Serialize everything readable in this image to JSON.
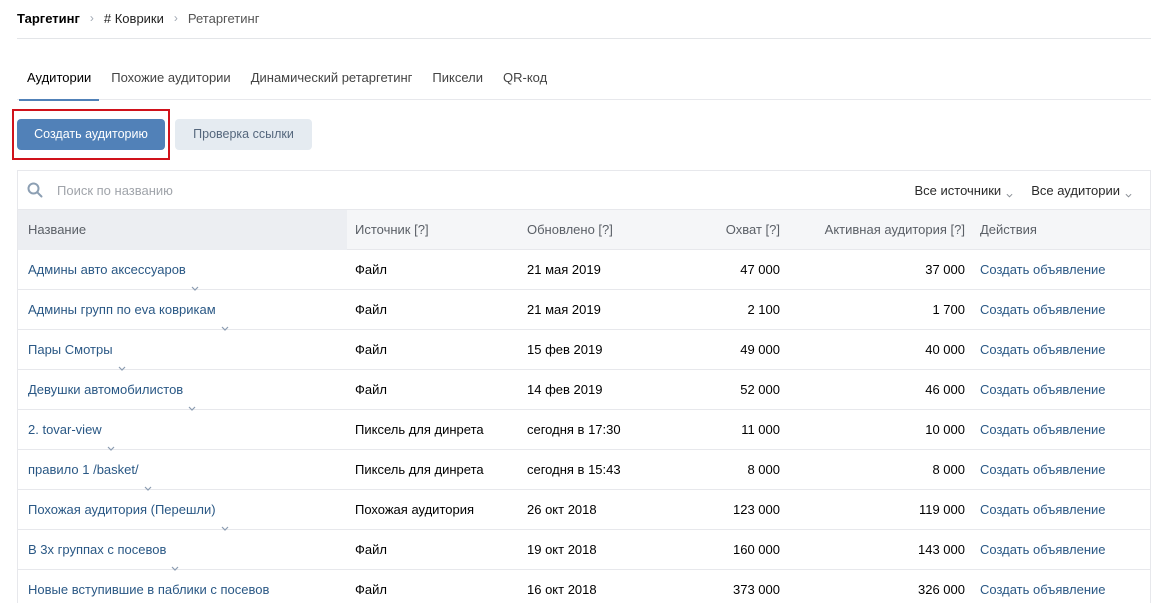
{
  "breadcrumb": {
    "root": "Таргетинг",
    "item1": "# Коврики",
    "item2": "Ретаргетинг"
  },
  "tabs": [
    {
      "label": "Аудитории",
      "active": true
    },
    {
      "label": "Похожие аудитории",
      "active": false
    },
    {
      "label": "Динамический ретаргетинг",
      "active": false
    },
    {
      "label": "Пиксели",
      "active": false
    },
    {
      "label": "QR-код",
      "active": false
    }
  ],
  "buttons": {
    "create": "Создать аудиторию",
    "check": "Проверка ссылки"
  },
  "search": {
    "placeholder": "Поиск по названию"
  },
  "filters": {
    "sources": "Все источники",
    "audiences": "Все аудитории"
  },
  "table": {
    "headers": {
      "name": "Название",
      "source": "Источник [?]",
      "updated": "Обновлено [?]",
      "reach": "Охват [?]",
      "active": "Активная аудитория [?]",
      "actions": "Действия"
    },
    "rows": [
      {
        "name": "Админы авто аксессуаров",
        "source": "Файл",
        "updated": "21 мая 2019",
        "reach": "47 000",
        "active": "37 000",
        "action": "Создать объявление"
      },
      {
        "name": "Админы групп по eva коврикам",
        "source": "Файл",
        "updated": "21 мая 2019",
        "reach": "2 100",
        "active": "1 700",
        "action": "Создать объявление"
      },
      {
        "name": "Пары Смотры",
        "source": "Файл",
        "updated": "15 фев 2019",
        "reach": "49 000",
        "active": "40 000",
        "action": "Создать объявление"
      },
      {
        "name": "Девушки автомобилистов",
        "source": "Файл",
        "updated": "14 фев 2019",
        "reach": "52 000",
        "active": "46 000",
        "action": "Создать объявление"
      },
      {
        "name": "2. tovar-view",
        "source": "Пиксель для динрета",
        "updated": "сегодня в 17:30",
        "reach": "11 000",
        "active": "10 000",
        "action": "Создать объявление"
      },
      {
        "name": "правило 1 /basket/",
        "source": "Пиксель для динрета",
        "updated": "сегодня в 15:43",
        "reach": "8 000",
        "active": "8 000",
        "action": "Создать объявление"
      },
      {
        "name": "Похожая аудитория (Перешли)",
        "source": "Похожая аудитория",
        "updated": "26 окт 2018",
        "reach": "123 000",
        "active": "119 000",
        "action": "Создать объявление"
      },
      {
        "name": "В 3х группах с посевов",
        "source": "Файл",
        "updated": "19 окт 2018",
        "reach": "160 000",
        "active": "143 000",
        "action": "Создать объявление"
      },
      {
        "name": "Новые вступившие в паблики с посевов",
        "source": "Файл",
        "updated": "16 окт 2018",
        "reach": "373 000",
        "active": "326 000",
        "action": "Создать объявление"
      }
    ]
  },
  "colors": {
    "accent": "#5181b8",
    "link": "#2a5885",
    "highlight": "#d0121b"
  }
}
